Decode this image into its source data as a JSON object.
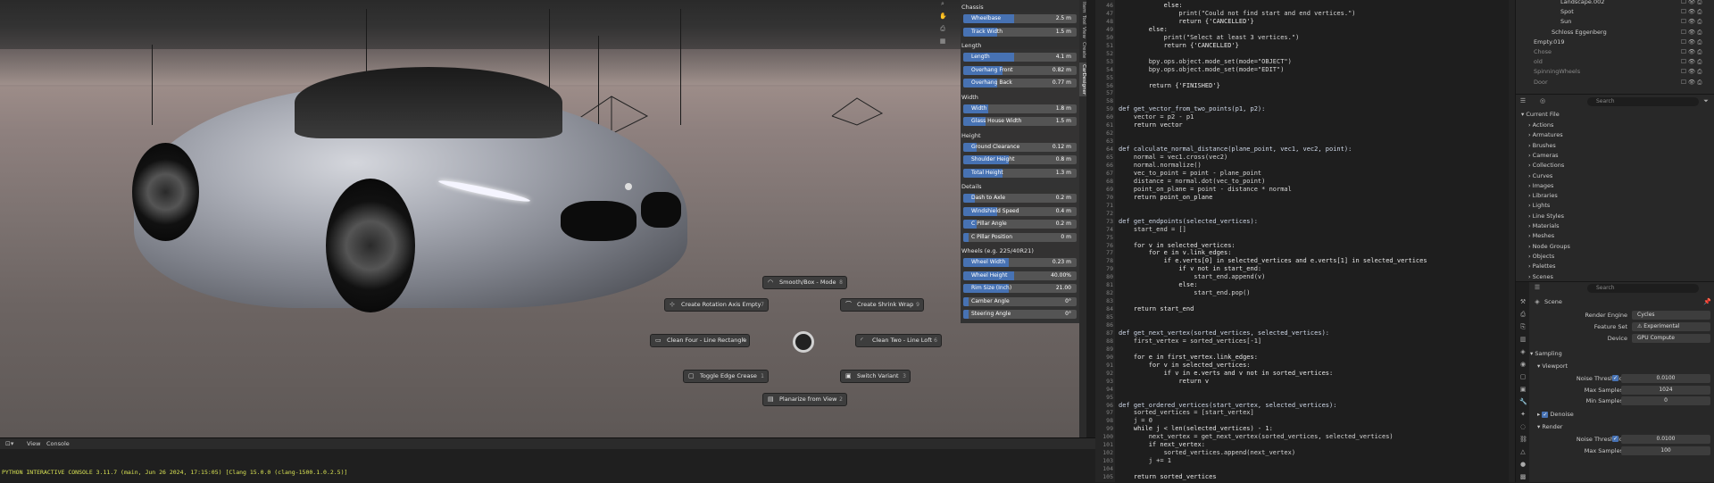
{
  "car_panel": {
    "sections": [
      {
        "title": "Chassis",
        "rows": [
          {
            "label": "Wheelbase",
            "value": "2.5 m",
            "fill": 0.45
          },
          {
            "label": "Track Width",
            "value": "1.5 m",
            "fill": 0.3
          }
        ]
      },
      {
        "title": "Length",
        "rows": [
          {
            "label": "Length",
            "value": "4.1 m",
            "fill": 0.45
          },
          {
            "label": "Overhang Front",
            "value": "0.82 m",
            "fill": 0.35
          },
          {
            "label": "Overhang Back",
            "value": "0.77 m",
            "fill": 0.3
          }
        ]
      },
      {
        "title": "Width",
        "rows": [
          {
            "label": "Width",
            "value": "1.8 m",
            "fill": 0.22
          },
          {
            "label": "Glass House Width",
            "value": "1.5 m",
            "fill": 0.2
          }
        ]
      },
      {
        "title": "Height",
        "rows": [
          {
            "label": "Ground Clearance",
            "value": "0.12 m",
            "fill": 0.12
          },
          {
            "label": "Shoulder Height",
            "value": "0.8 m",
            "fill": 0.4
          },
          {
            "label": "Total Height",
            "value": "1.3 m",
            "fill": 0.35
          }
        ]
      },
      {
        "title": "Details",
        "rows": [
          {
            "label": "Dash to Axle",
            "value": "0.2 m",
            "fill": 0.1
          },
          {
            "label": "Windshield Speed",
            "value": "0.4 m",
            "fill": 0.3
          },
          {
            "label": "C Pillar Angle",
            "value": "0.2 m",
            "fill": 0.12
          },
          {
            "label": "C Pillar Position",
            "value": "0 m",
            "fill": 0.05
          }
        ]
      },
      {
        "title": "Wheels (e.g. 225/40R21)",
        "rows": [
          {
            "label": "Wheel Width",
            "value": "0.23 m",
            "fill": 0.4
          },
          {
            "label": "Wheel Height",
            "value": "40.00%",
            "fill": 0.45
          },
          {
            "label": "Rim Size (Inch)",
            "value": "21.00",
            "fill": 0.4
          },
          {
            "label": "Camber Angle",
            "value": "0°",
            "fill": 0.05
          },
          {
            "label": "Steering Angle",
            "value": "0°",
            "fill": 0.05
          }
        ]
      }
    ]
  },
  "pie_menu": {
    "smooth_box": {
      "label": "Smooth/Box - Mode",
      "num": "8"
    },
    "rotation_axis": {
      "label": "Create Rotation Axis Empty",
      "num": "7"
    },
    "shrink_wrap": {
      "label": "Create Shrink Wrap",
      "num": "9"
    },
    "four_line": {
      "label": "Clean Four - Line Rectangle",
      "num": "4"
    },
    "two_line": {
      "label": "Clean Two - Line Loft",
      "num": "6"
    },
    "toggle_crease": {
      "label": "Toggle Edge Crease",
      "num": "1"
    },
    "switch_variant": {
      "label": "Switch Variant",
      "num": "3"
    },
    "planarize": {
      "label": "Planarize from View",
      "num": "2"
    }
  },
  "viewport_tabs": [
    "Item",
    "Tool",
    "View",
    "Create",
    "CarDesigner"
  ],
  "console": {
    "menu": [
      "View",
      "Console"
    ],
    "line": "PYTHON INTERACTIVE CONSOLE 3.11.7 (main, Jun 26 2024, 17:15:05) [Clang 15.0.0 (clang-1500.1.0.2.5)]"
  },
  "code": [
    {
      "n": "46",
      "t": "            else:"
    },
    {
      "n": "47",
      "t": "                print(\"Could not find start and end vertices.\")"
    },
    {
      "n": "48",
      "t": "                return {'CANCELLED'}"
    },
    {
      "n": "49",
      "t": "        else:"
    },
    {
      "n": "50",
      "t": "            print(\"Select at least 3 vertices.\")"
    },
    {
      "n": "51",
      "t": "            return {'CANCELLED'}"
    },
    {
      "n": "52",
      "t": ""
    },
    {
      "n": "53",
      "t": "        bpy.ops.object.mode_set(mode=\"OBJECT\")"
    },
    {
      "n": "54",
      "t": "        bpy.ops.object.mode_set(mode=\"EDIT\")"
    },
    {
      "n": "55",
      "t": ""
    },
    {
      "n": "56",
      "t": "        return {'FINISHED'}"
    },
    {
      "n": "57",
      "t": ""
    },
    {
      "n": "58",
      "t": ""
    },
    {
      "n": "59",
      "t": "def get_vector_from_two_points(p1, p2):"
    },
    {
      "n": "60",
      "t": "    vector = p2 - p1"
    },
    {
      "n": "61",
      "t": "    return vector"
    },
    {
      "n": "62",
      "t": ""
    },
    {
      "n": "63",
      "t": ""
    },
    {
      "n": "64",
      "t": "def calculate_normal_distance(plane_point, vec1, vec2, point):"
    },
    {
      "n": "65",
      "t": "    normal = vec1.cross(vec2)"
    },
    {
      "n": "66",
      "t": "    normal.normalize()"
    },
    {
      "n": "67",
      "t": "    vec_to_point = point - plane_point"
    },
    {
      "n": "68",
      "t": "    distance = normal.dot(vec_to_point)"
    },
    {
      "n": "69",
      "t": "    point_on_plane = point - distance * normal"
    },
    {
      "n": "70",
      "t": "    return point_on_plane"
    },
    {
      "n": "71",
      "t": ""
    },
    {
      "n": "72",
      "t": ""
    },
    {
      "n": "73",
      "t": "def get_endpoints(selected_vertices):"
    },
    {
      "n": "74",
      "t": "    start_end = []"
    },
    {
      "n": "75",
      "t": ""
    },
    {
      "n": "76",
      "t": "    for v in selected_vertices:"
    },
    {
      "n": "77",
      "t": "        for e in v.link_edges:"
    },
    {
      "n": "78",
      "t": "            if e.verts[0] in selected_vertices and e.verts[1] in selected_vertices"
    },
    {
      "n": "79",
      "t": "                if v not in start_end:"
    },
    {
      "n": "80",
      "t": "                    start_end.append(v)"
    },
    {
      "n": "81",
      "t": "                else:"
    },
    {
      "n": "82",
      "t": "                    start_end.pop()"
    },
    {
      "n": "83",
      "t": ""
    },
    {
      "n": "84",
      "t": "    return start_end"
    },
    {
      "n": "85",
      "t": ""
    },
    {
      "n": "86",
      "t": ""
    },
    {
      "n": "87",
      "t": "def get_next_vertex(sorted_vertices, selected_vertices):"
    },
    {
      "n": "88",
      "t": "    first_vertex = sorted_vertices[-1]"
    },
    {
      "n": "89",
      "t": ""
    },
    {
      "n": "90",
      "t": "    for e in first_vertex.link_edges:"
    },
    {
      "n": "91",
      "t": "        for v in selected_vertices:"
    },
    {
      "n": "92",
      "t": "            if v in e.verts and v not in sorted_vertices:"
    },
    {
      "n": "93",
      "t": "                return v"
    },
    {
      "n": "94",
      "t": ""
    },
    {
      "n": "95",
      "t": ""
    },
    {
      "n": "96",
      "t": "def get_ordered_vertices(start_vertex, selected_vertices):"
    },
    {
      "n": "97",
      "t": "    sorted_vertices = [start_vertex]"
    },
    {
      "n": "98",
      "t": "    j = 0"
    },
    {
      "n": "99",
      "t": "    while j < len(selected_vertices) - 1:"
    },
    {
      "n": "100",
      "t": "        next_vertex = get_next_vertex(sorted_vertices, selected_vertices)"
    },
    {
      "n": "101",
      "t": "        if next_vertex:"
    },
    {
      "n": "102",
      "t": "            sorted_vertices.append(next_vertex)"
    },
    {
      "n": "103",
      "t": "        j += 1"
    },
    {
      "n": "104",
      "t": ""
    },
    {
      "n": "105",
      "t": "    return sorted_vertices"
    }
  ],
  "outliner": {
    "items": [
      "Landscape.002",
      "Spot",
      "Sun",
      "Schloss Eggenberg",
      "Empty.019",
      "Chose",
      "old",
      "SpinningWheels",
      "Door"
    ]
  },
  "file_browser": {
    "search_placeholder": "Search",
    "header": "Current File",
    "items": [
      "Actions",
      "Armatures",
      "Brushes",
      "Cameras",
      "Collections",
      "Curves",
      "Images",
      "Libraries",
      "Lights",
      "Line Styles",
      "Materials",
      "Meshes",
      "Node Groups",
      "Objects",
      "Palettes",
      "Scenes"
    ]
  },
  "properties": {
    "search_placeholder": "Search",
    "scene_label": "Scene",
    "render_engine_label": "Render Engine",
    "render_engine": "Cycles",
    "feature_set_label": "Feature Set",
    "feature_set": "Experimental",
    "device_label": "Device",
    "device": "GPU Compute",
    "sampling": "Sampling",
    "viewport": "Viewport",
    "noise_threshold_label": "Noise Threshold",
    "noise_threshold": "0.0100",
    "max_samples_label": "Max Samples",
    "max_samples": "1024",
    "min_samples_label": "Min Samples",
    "min_samples": "0",
    "denoise": "Denoise",
    "render": "Render",
    "render_noise_threshold": "0.0100",
    "render_max_samples": "100"
  },
  "colors": {
    "accent": "#4772b3",
    "panel": "#303030",
    "editor_bg": "#1e1e1e"
  }
}
